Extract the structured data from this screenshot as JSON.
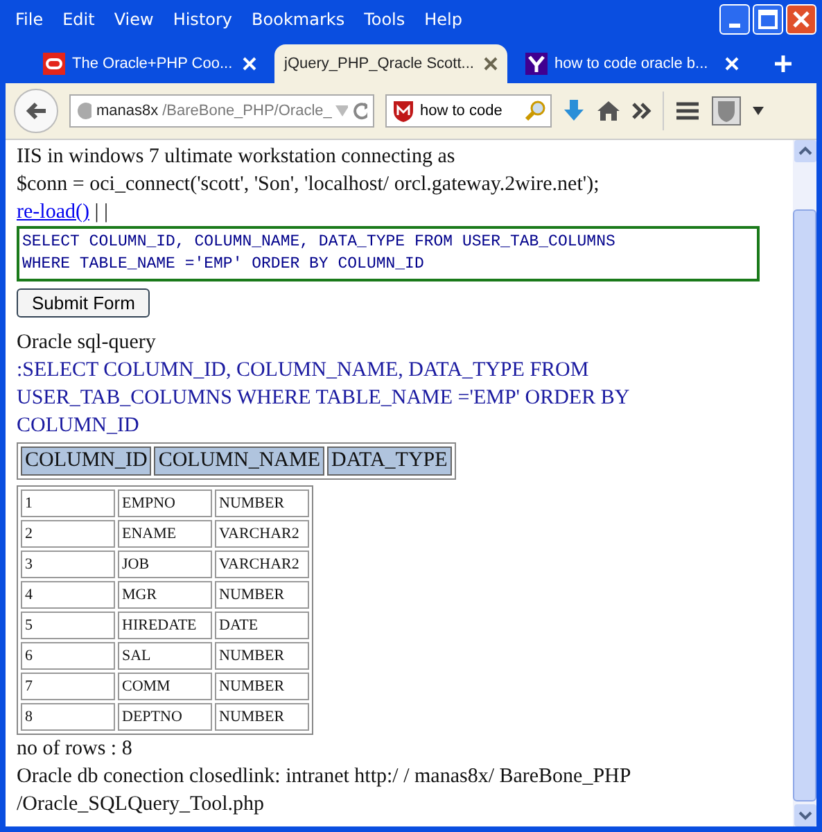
{
  "window": {
    "menu": [
      "File",
      "Edit",
      "View",
      "History",
      "Bookmarks",
      "Tools",
      "Help"
    ]
  },
  "tabs": [
    {
      "title": "The Oracle+PHP Coo...",
      "kind": "oracle",
      "selected": false
    },
    {
      "title": "jQuery_PHP_Qracle Scott...",
      "kind": "none",
      "selected": true
    },
    {
      "title": "how to code oracle b...",
      "kind": "yahoo",
      "selected": false
    }
  ],
  "url": {
    "host": "manas8x",
    "path": "/BareBone_PHP/Oracle_"
  },
  "search": {
    "value": "how to code"
  },
  "page": {
    "intro": [
      "IIS in windows 7 ultimate workstation connecting as",
      "$conn = oci_connect('scott', 'Son', 'localhost/ orcl.gateway.2wire.net');"
    ],
    "link": "re-load()",
    "after_link": "| |",
    "query": "SELECT COLUMN_ID, COLUMN_NAME, DATA_TYPE FROM USER_TAB_COLUMNS\nWHERE TABLE_NAME ='EMP' ORDER BY COLUMN_ID",
    "submit": "Submit Form",
    "heading": "Oracle sql-query",
    "echo": ":SELECT COLUMN_ID, COLUMN_NAME, DATA_TYPE FROM USER_TAB_COLUMNS WHERE TABLE_NAME ='EMP' ORDER BY COLUMN_ID",
    "columns": [
      "COLUMN_ID",
      "COLUMN_NAME",
      "DATA_TYPE"
    ],
    "rows": [
      [
        "1",
        "EMPNO",
        "NUMBER"
      ],
      [
        "2",
        "ENAME",
        "VARCHAR2"
      ],
      [
        "3",
        "JOB",
        "VARCHAR2"
      ],
      [
        "4",
        "MGR",
        "NUMBER"
      ],
      [
        "5",
        "HIREDATE",
        "DATE"
      ],
      [
        "6",
        "SAL",
        "NUMBER"
      ],
      [
        "7",
        "COMM",
        "NUMBER"
      ],
      [
        "8",
        "DEPTNO",
        "NUMBER"
      ]
    ],
    "footer": [
      "no of rows : 8",
      "Oracle db conection closedlink: intranet http:/ / manas8x/ BareBone_PHP /Oracle_SQLQuery_Tool.php"
    ]
  }
}
